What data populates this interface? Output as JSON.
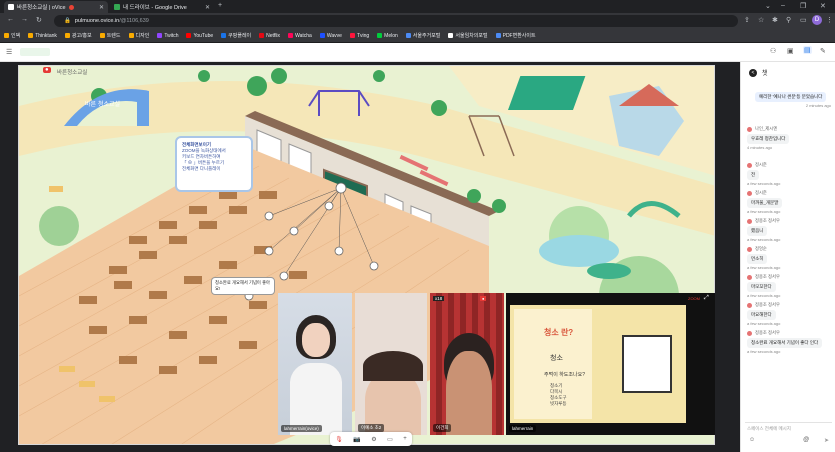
{
  "tabs": [
    {
      "title": "바른청소교실 | oVice",
      "active": true,
      "color": "#e8eaed"
    },
    {
      "title": "내 드라이브 - Google Drive",
      "active": false,
      "color": "#34a853"
    }
  ],
  "address": {
    "domain": "pulmuone.ovice.in",
    "path": "/@1106,639"
  },
  "bookmarks": [
    {
      "label": "인덱",
      "color": "#f9ab00"
    },
    {
      "label": "Thinktank",
      "color": "#f9ab00"
    },
    {
      "label": "광고/홍보",
      "color": "#f9ab00"
    },
    {
      "label": "트렌드",
      "color": "#f9ab00"
    },
    {
      "label": "디자인",
      "color": "#f9ab00"
    },
    {
      "label": "Twitch",
      "color": "#9146ff"
    },
    {
      "label": "YouTube",
      "color": "#ff0000"
    },
    {
      "label": "쿠팡플레이",
      "color": "#1a73e8"
    },
    {
      "label": "Netflix",
      "color": "#e50914"
    },
    {
      "label": "Watcha",
      "color": "#ff0558"
    },
    {
      "label": "Wavve",
      "color": "#1e50ff"
    },
    {
      "label": "Tving",
      "color": "#ff153c"
    },
    {
      "label": "Melon",
      "color": "#00cd3c"
    },
    {
      "label": "서울주거포털",
      "color": "#4c8bf5"
    },
    {
      "label": "서울임차의포털",
      "color": "#ffffff"
    },
    {
      "label": "PDF변환사이트",
      "color": "#4c8bf5"
    }
  ],
  "room": {
    "name": "바른청소교실",
    "entrance_sign": "바른 청소교실"
  },
  "bubble": {
    "title": "전체화면보이기",
    "lines": [
      "ZOOM을 녹화상태에서",
      "키보드 연차버튼하여",
      "「 ⊕ 」버튼을 누르기",
      "전체화면 다니플레이"
    ]
  },
  "tooltip": {
    "text": "청소완료 개요해서 기념이 좋아요!"
  },
  "videos": [
    {
      "name": "lahmerrain(ovice)",
      "badge": ""
    },
    {
      "name": "이예소 초2",
      "badge": ""
    },
    {
      "name": "이건희",
      "badge": "x18"
    },
    {
      "name": "lahmerrain",
      "badge": "ZOOM"
    }
  ],
  "slide": {
    "title": "청소 란?",
    "subtitle": "주먹이 하도조나요?",
    "bullets": [
      "청소기",
      "다목시",
      "청소도구",
      "빗자루등"
    ],
    "badge": "청소"
  },
  "control_icons": [
    "mic",
    "camera",
    "settings",
    "share",
    "plus"
  ],
  "chat": {
    "title": "챗",
    "input_placeholder": "스페이스 전체에 메시지",
    "messages": [
      {
        "user": "",
        "text": "예리한 '예나나 썬분'등 분았습니다",
        "time": "2 minutes ago",
        "self": true
      },
      {
        "user": "나인_제시엔",
        "text": "우효레 청찬입니다",
        "time": "4 minutes ago",
        "self": false
      },
      {
        "user": "정시준",
        "text": "전",
        "time": "a few seconds ago",
        "self": false
      },
      {
        "user": "정시준",
        "text": "마까물_개문말",
        "time": "a few seconds ago",
        "self": false
      },
      {
        "user": "정용조 정서우",
        "text": "했음니",
        "time": "a few seconds ago",
        "self": false
      },
      {
        "user": "정엉순",
        "text": "먼소히",
        "time": "a few seconds ago",
        "self": false
      },
      {
        "user": "정용조 정서우",
        "text": "마모꼬한다",
        "time": "a few seconds ago",
        "self": false
      },
      {
        "user": "정용조 정서우",
        "text": "마요해한다",
        "time": "a few seconds ago",
        "self": false
      },
      {
        "user": "정용조 정서우",
        "text": "청소완료 개요해서 기념이 좋다 인다",
        "time": "a few seconds ago",
        "self": false
      }
    ]
  },
  "colors": {
    "accent": "#3b55a0",
    "map_ground": "#e9f2d2",
    "floor": "#f2c9a0"
  }
}
